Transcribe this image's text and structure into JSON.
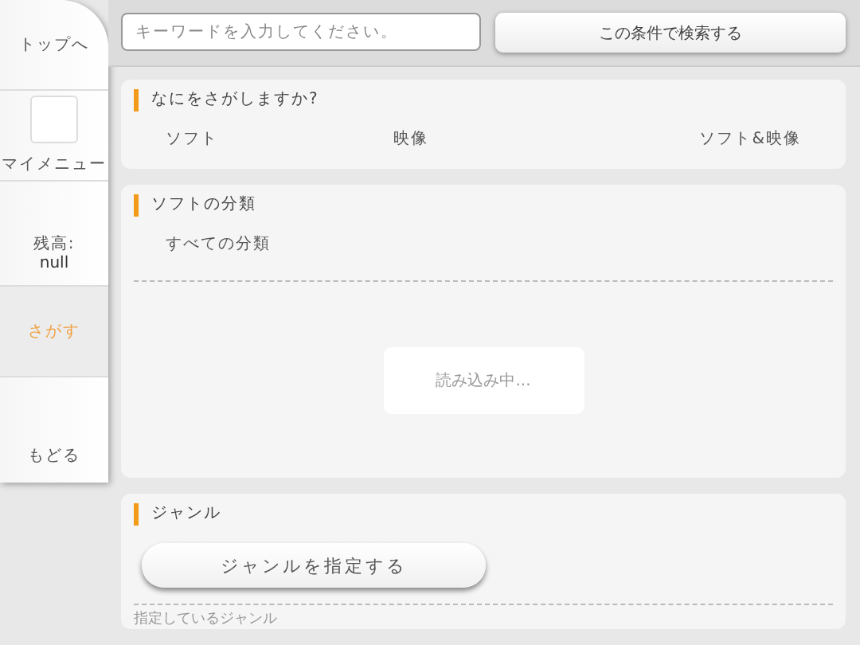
{
  "sidebar": {
    "items": [
      {
        "kind": "link",
        "label": "トップへ",
        "selected": false
      },
      {
        "kind": "menu",
        "label": "マイメニュー",
        "selected": false
      },
      {
        "kind": "balance",
        "label": "残高:",
        "value": "null",
        "selected": false
      },
      {
        "kind": "link",
        "label": "さがす",
        "selected": true
      },
      {
        "kind": "link",
        "label": "もどる",
        "selected": false
      }
    ]
  },
  "search": {
    "placeholder": "キーワードを入力してください。",
    "button": "この条件で検索する"
  },
  "panels": [
    {
      "kind": "options",
      "title": "なにをさがしますか?",
      "options": [
        "ソフト",
        "映像",
        "ソフト&映像"
      ]
    },
    {
      "kind": "category",
      "title": "ソフトの分類",
      "value": "すべての分類",
      "loading": "読み込み中..."
    },
    {
      "kind": "genre",
      "title": "ジャンル",
      "button": "ジャンルを指定する",
      "note": "指定しているジャンル"
    }
  ]
}
